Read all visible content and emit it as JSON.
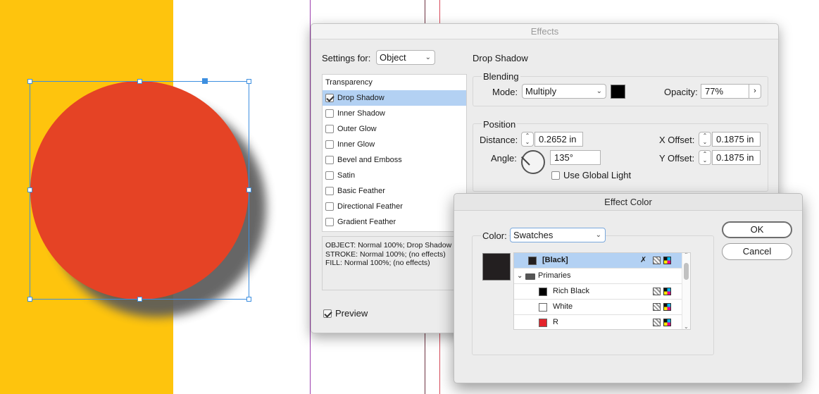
{
  "effects_dialog": {
    "title": "Effects",
    "settings_for_label": "Settings for:",
    "settings_for_value": "Object",
    "section_title": "Drop Shadow",
    "effects_list": [
      {
        "label": "Transparency",
        "has_checkbox": false,
        "checked": false,
        "selected": false
      },
      {
        "label": "Drop Shadow",
        "has_checkbox": true,
        "checked": true,
        "selected": true
      },
      {
        "label": "Inner Shadow",
        "has_checkbox": true,
        "checked": false,
        "selected": false
      },
      {
        "label": "Outer Glow",
        "has_checkbox": true,
        "checked": false,
        "selected": false
      },
      {
        "label": "Inner Glow",
        "has_checkbox": true,
        "checked": false,
        "selected": false
      },
      {
        "label": "Bevel and Emboss",
        "has_checkbox": true,
        "checked": false,
        "selected": false
      },
      {
        "label": "Satin",
        "has_checkbox": true,
        "checked": false,
        "selected": false
      },
      {
        "label": "Basic Feather",
        "has_checkbox": true,
        "checked": false,
        "selected": false
      },
      {
        "label": "Directional Feather",
        "has_checkbox": true,
        "checked": false,
        "selected": false
      },
      {
        "label": "Gradient Feather",
        "has_checkbox": true,
        "checked": false,
        "selected": false
      }
    ],
    "summary": {
      "line1": "OBJECT: Normal 100%; Drop Shadow",
      "line2": "STROKE: Normal 100%; (no effects)",
      "line3": "FILL: Normal 100%; (no effects)"
    },
    "preview_label": "Preview",
    "preview_checked": true,
    "blending": {
      "title": "Blending",
      "mode_label": "Mode:",
      "mode_value": "Multiply",
      "opacity_label": "Opacity:",
      "opacity_value": "77%",
      "color": "#000000"
    },
    "position": {
      "title": "Position",
      "distance_label": "Distance:",
      "distance_value": "0.2652 in",
      "angle_label": "Angle:",
      "angle_value": "135°",
      "use_global_light_label": "Use Global Light",
      "x_offset_label": "X Offset:",
      "x_offset_value": "0.1875 in",
      "y_offset_label": "Y Offset:",
      "y_offset_value": "0.1875 in"
    }
  },
  "effect_color_dialog": {
    "title": "Effect Color",
    "color_label": "Color:",
    "color_value": "Swatches",
    "preview_color": "#231f20",
    "ok_label": "OK",
    "cancel_label": "Cancel",
    "swatches": [
      {
        "name": "[Black]",
        "color": "#231f20",
        "type": "swatch",
        "selected": true
      },
      {
        "name": "Primaries",
        "type": "folder",
        "selected": false
      },
      {
        "name": "Rich Black",
        "color": "#000000",
        "type": "swatch",
        "selected": false
      },
      {
        "name": "White",
        "color": "#ffffff",
        "type": "swatch",
        "selected": false
      },
      {
        "name": "R",
        "color": "#e3242b",
        "type": "swatch",
        "selected": false
      }
    ]
  },
  "canvas": {
    "background_color": "#FEC40D",
    "circle_color": "#E54325",
    "shadow_color": "#5a5a5a"
  }
}
